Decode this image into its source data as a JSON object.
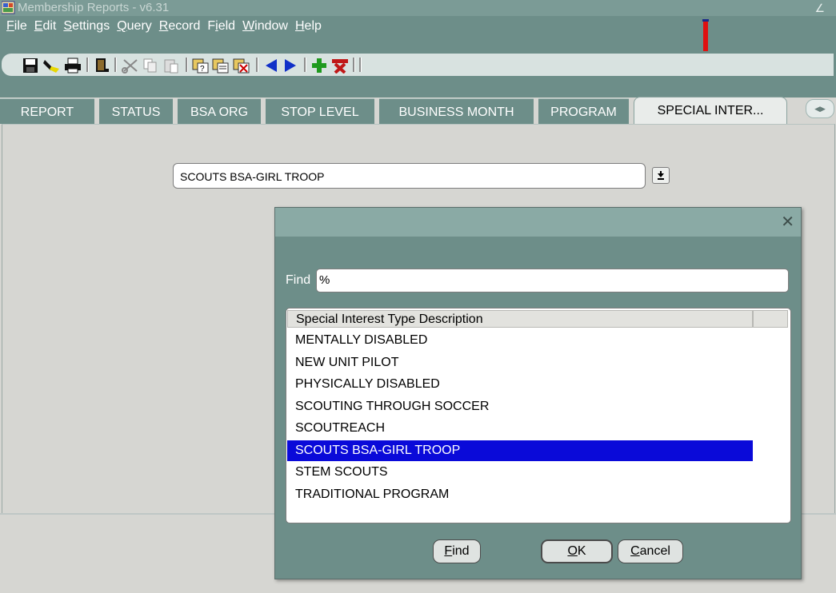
{
  "window": {
    "title": "Membership Reports - v6.31"
  },
  "menu": [
    {
      "label": "File",
      "mnemonic": "F",
      "rest": "ile"
    },
    {
      "label": "Edit",
      "mnemonic": "E",
      "rest": "dit"
    },
    {
      "label": "Settings",
      "mnemonic": "S",
      "rest": "ettings"
    },
    {
      "label": "Query",
      "mnemonic": "Q",
      "rest": "uery"
    },
    {
      "label": "Record",
      "mnemonic": "R",
      "rest": "ecord"
    },
    {
      "label": "Field",
      "mnemonic": "i",
      "pre": "F",
      "rest": "eld"
    },
    {
      "label": "Window",
      "mnemonic": "W",
      "rest": "indow"
    },
    {
      "label": "Help",
      "mnemonic": "H",
      "rest": "elp"
    }
  ],
  "toolbar": {
    "icons": [
      "save-icon",
      "clear-form-icon",
      "print-icon",
      "exit-icon",
      "cut-icon",
      "copy-icon",
      "paste-icon",
      "enter-query-icon",
      "execute-query-icon",
      "cancel-query-icon",
      "previous-record-icon",
      "next-record-icon",
      "insert-record-icon",
      "delete-record-icon"
    ]
  },
  "tabs": {
    "report": "REPORT",
    "status": "STATUS",
    "bsa_org": "BSA ORG",
    "stop_level": "STOP LEVEL",
    "business_month": "BUSINESS MONTH",
    "program": "PROGRAM",
    "special_interest": "SPECIAL INTER..."
  },
  "main": {
    "selected_value": "SCOUTS BSA-GIRL TROOP"
  },
  "dialog": {
    "find_label": "Find",
    "find_value": "%",
    "column_header": "Special Interest Type Description",
    "items": [
      "MENTALLY DISABLED",
      "NEW UNIT PILOT",
      "PHYSICALLY DISABLED",
      "SCOUTING THROUGH SOCCER",
      "SCOUTREACH",
      "SCOUTS BSA-GIRL TROOP",
      "STEM SCOUTS",
      "TRADITIONAL PROGRAM"
    ],
    "selected_index": 5,
    "buttons": {
      "find": "Find",
      "ok": "OK",
      "cancel": "Cancel"
    }
  },
  "colors": {
    "chrome": "#6d8e89",
    "selection": "#0a0ad9",
    "annotation_arrow": "#e01010"
  }
}
